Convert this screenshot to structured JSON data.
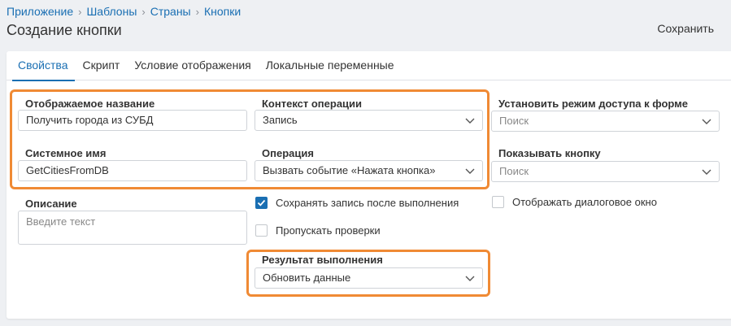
{
  "breadcrumb": [
    "Приложение",
    "Шаблоны",
    "Страны",
    "Кнопки"
  ],
  "page": {
    "title": "Создание кнопки",
    "save_label": "Сохранить"
  },
  "tabs": [
    {
      "label": "Свойства",
      "active": true
    },
    {
      "label": "Скрипт",
      "active": false
    },
    {
      "label": "Условие отображения",
      "active": false
    },
    {
      "label": "Локальные переменные",
      "active": false
    }
  ],
  "form": {
    "display_name": {
      "label": "Отображаемое название",
      "value": "Получить города из СУБД"
    },
    "system_name": {
      "label": "Системное имя",
      "value": "GetCitiesFromDB"
    },
    "context": {
      "label": "Контекст операции",
      "value": "Запись"
    },
    "operation": {
      "label": "Операция",
      "value": "Вызвать событие «Нажата кнопка»"
    },
    "access_mode": {
      "label": "Установить режим доступа к форме",
      "placeholder": "Поиск"
    },
    "show_button": {
      "label": "Показывать кнопку",
      "placeholder": "Поиск"
    },
    "description": {
      "label": "Описание",
      "placeholder": "Введите текст"
    },
    "save_after": {
      "label": "Сохранять запись после выполнения",
      "checked": true
    },
    "skip_checks": {
      "label": "Пропускать проверки",
      "checked": false
    },
    "show_dialog": {
      "label": "Отображать диалоговое окно",
      "checked": false
    },
    "result": {
      "label": "Результат выполнения",
      "value": "Обновить данные"
    }
  },
  "icons": {
    "breadcrumb_separator": "chevron-right-icon",
    "select_arrow": "chevron-down-icon",
    "checkbox_mark": "check-icon"
  },
  "colors": {
    "accent": "#1a6fb3",
    "highlight": "#f08a34",
    "background": "#eef0f3"
  }
}
